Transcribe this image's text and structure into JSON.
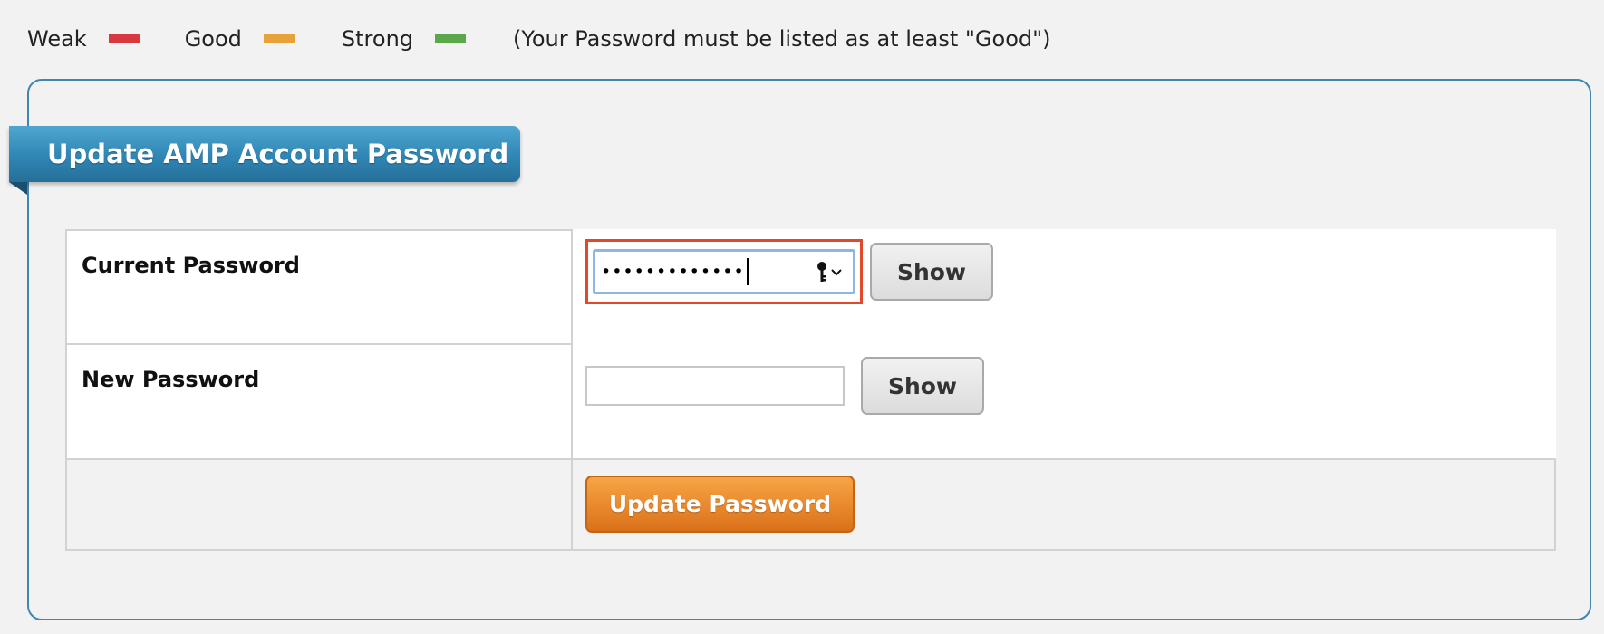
{
  "legend": {
    "weak_label": "Weak",
    "good_label": "Good",
    "strong_label": "Strong",
    "note": "(Your Password must be listed as at least \"Good\")",
    "colors": {
      "weak": "#d9383e",
      "good": "#e8a23a",
      "strong": "#5aa84a"
    }
  },
  "panel": {
    "title": "Update AMP Account Password"
  },
  "form": {
    "current_password": {
      "label": "Current Password",
      "value_masked": "•••••••••••••",
      "show_label": "Show"
    },
    "new_password": {
      "label": "New Password",
      "value": "",
      "show_label": "Show"
    },
    "submit_label": "Update Password"
  },
  "colors": {
    "accent_blue": "#2f86b5",
    "panel_border": "#3f87ad",
    "highlight": "#e04a2b",
    "submit_orange": "#e9882c"
  }
}
